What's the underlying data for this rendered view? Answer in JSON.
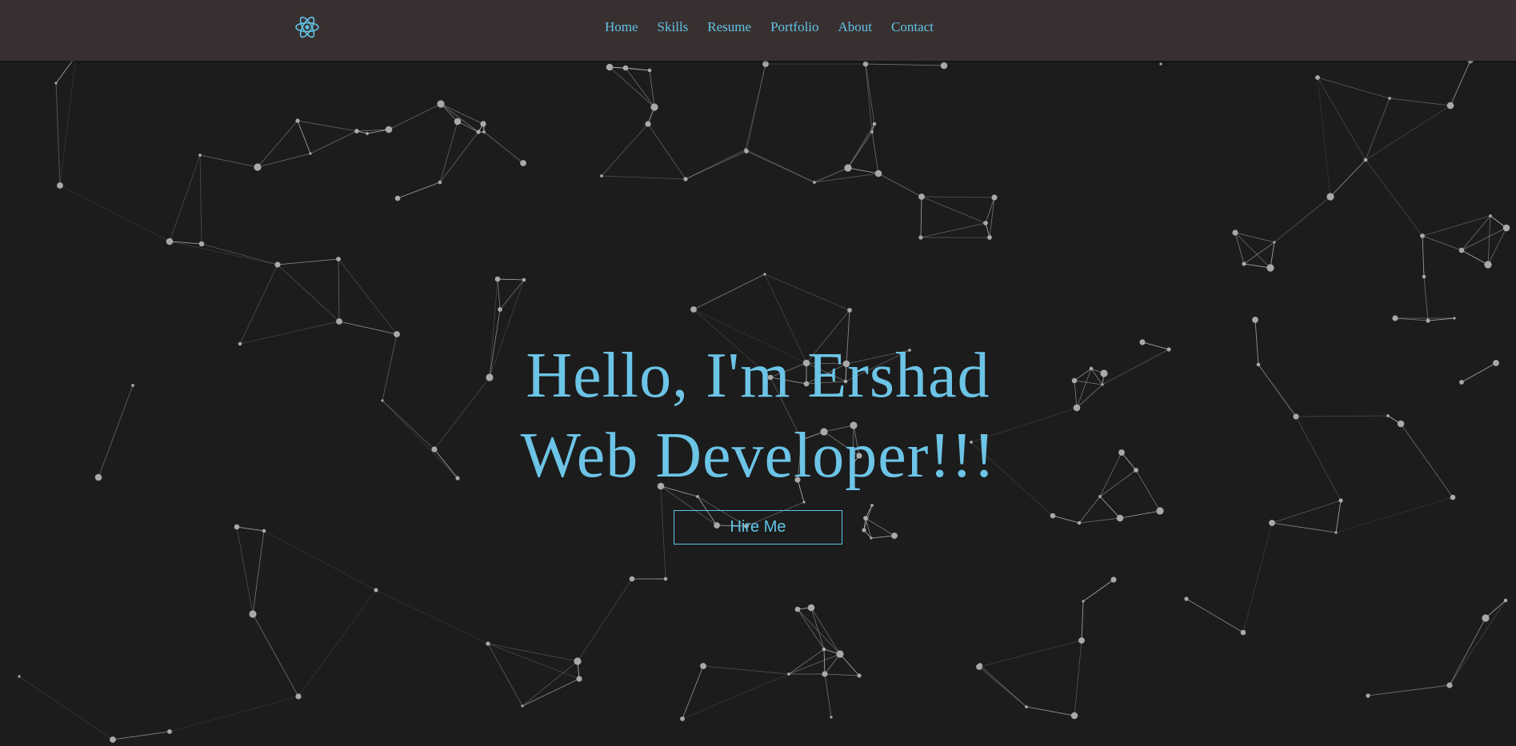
{
  "brand": {
    "logo_icon": "atom-icon"
  },
  "nav": {
    "items": [
      {
        "label": "Home"
      },
      {
        "label": "Skills"
      },
      {
        "label": "Resume"
      },
      {
        "label": "Portfolio"
      },
      {
        "label": "About"
      },
      {
        "label": "Contact"
      }
    ]
  },
  "hero": {
    "line1": "Hello, I'm Ershad",
    "line2": "Web Developer!!!",
    "cta_label": "Hire Me"
  },
  "colors": {
    "accent": "#61c4e6",
    "navbar_bg": "#383030",
    "page_bg": "#1c1c1c",
    "particle": "#bdbdbd"
  }
}
